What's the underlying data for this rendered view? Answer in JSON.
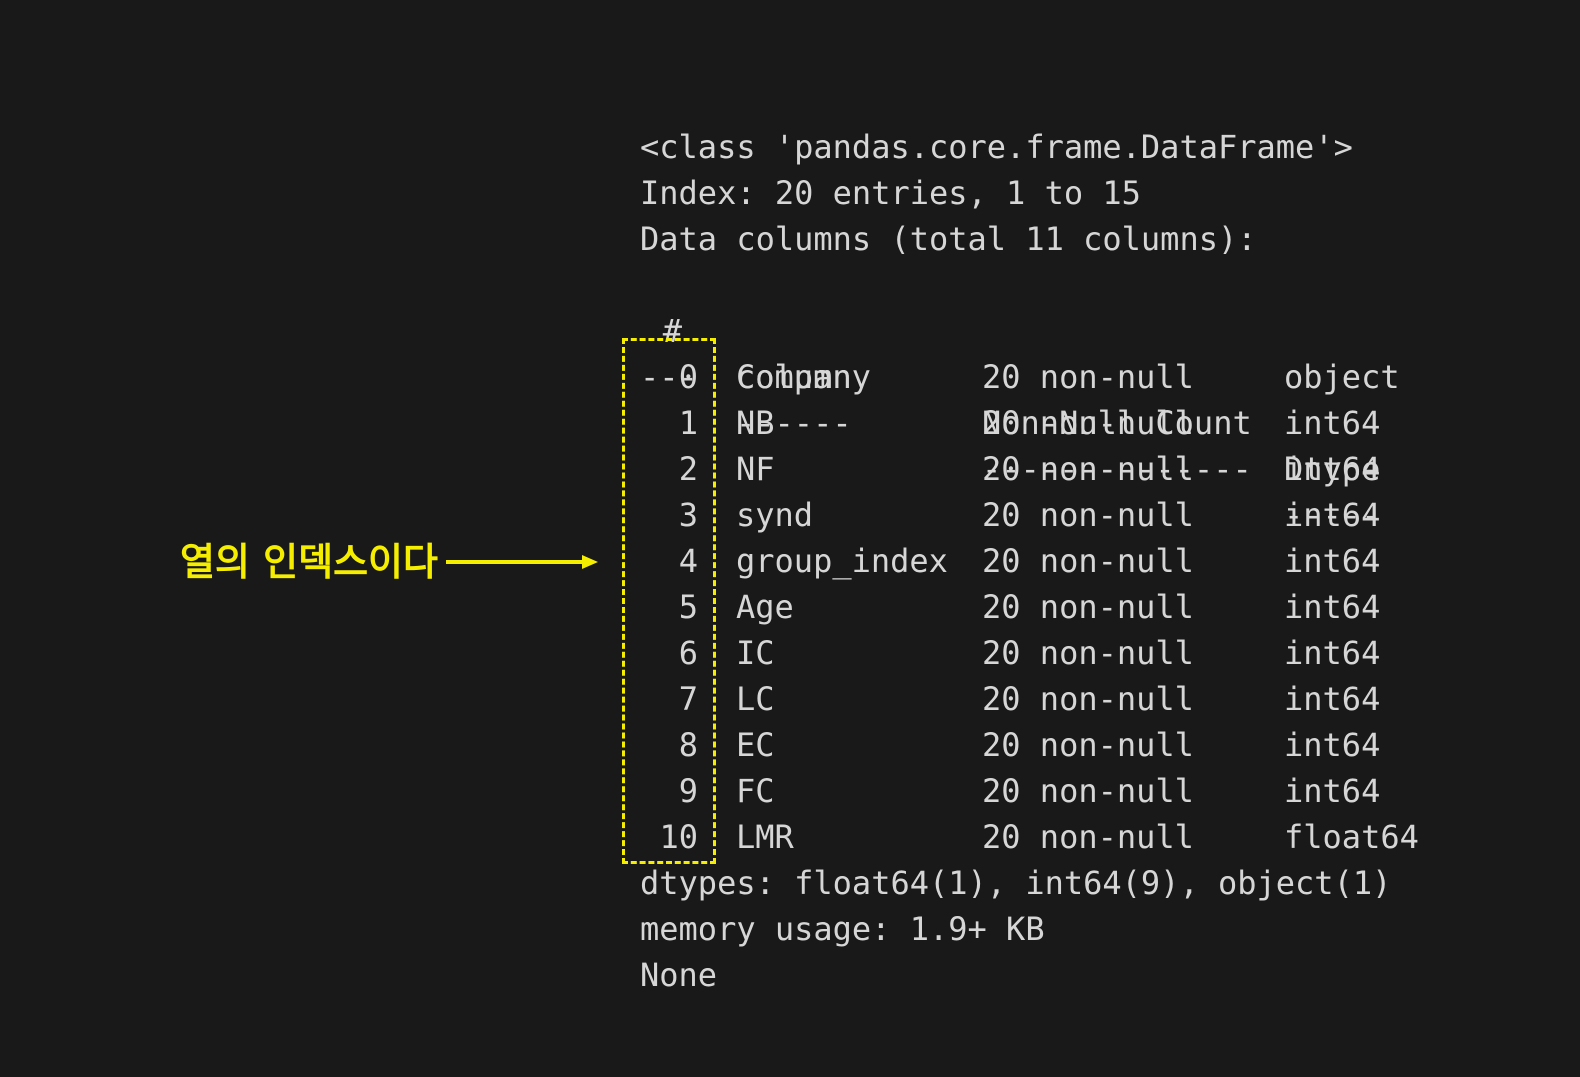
{
  "header": {
    "class_line": "<class 'pandas.core.frame.DataFrame'>",
    "index_line": "Index: 20 entries, 1 to 15",
    "data_columns_line": "Data columns (total 11 columns):"
  },
  "table": {
    "header": {
      "idx": "#",
      "name": "Column",
      "count": "Non-Null Count",
      "dtype": "Dtype"
    },
    "separator": {
      "idx": "---",
      "name": "------",
      "count": "--------------",
      "dtype": "-----"
    },
    "rows": [
      {
        "idx": "0",
        "name": "company",
        "count": "20 non-null",
        "dtype": "object"
      },
      {
        "idx": "1",
        "name": "NB",
        "count": "20 non-null",
        "dtype": "int64"
      },
      {
        "idx": "2",
        "name": "NF",
        "count": "20 non-null",
        "dtype": "int64"
      },
      {
        "idx": "3",
        "name": "synd",
        "count": "20 non-null",
        "dtype": "int64"
      },
      {
        "idx": "4",
        "name": "group_index",
        "count": "20 non-null",
        "dtype": "int64"
      },
      {
        "idx": "5",
        "name": "Age",
        "count": "20 non-null",
        "dtype": "int64"
      },
      {
        "idx": "6",
        "name": "IC",
        "count": "20 non-null",
        "dtype": "int64"
      },
      {
        "idx": "7",
        "name": "LC",
        "count": "20 non-null",
        "dtype": "int64"
      },
      {
        "idx": "8",
        "name": "EC",
        "count": "20 non-null",
        "dtype": "int64"
      },
      {
        "idx": "9",
        "name": "FC",
        "count": "20 non-null",
        "dtype": "int64"
      },
      {
        "idx": "10",
        "name": "LMR",
        "count": "20 non-null",
        "dtype": "float64"
      }
    ]
  },
  "footer": {
    "dtypes_line": "dtypes: float64(1), int64(9), object(1)",
    "memory_line": "memory usage: 1.9+ KB",
    "none_line": "None"
  },
  "annotation": {
    "label": "열의 인덱스이다",
    "color": "#f6ee00"
  },
  "colors": {
    "background": "#191919",
    "text": "#d6d6d6",
    "highlight": "#f6ee00"
  }
}
